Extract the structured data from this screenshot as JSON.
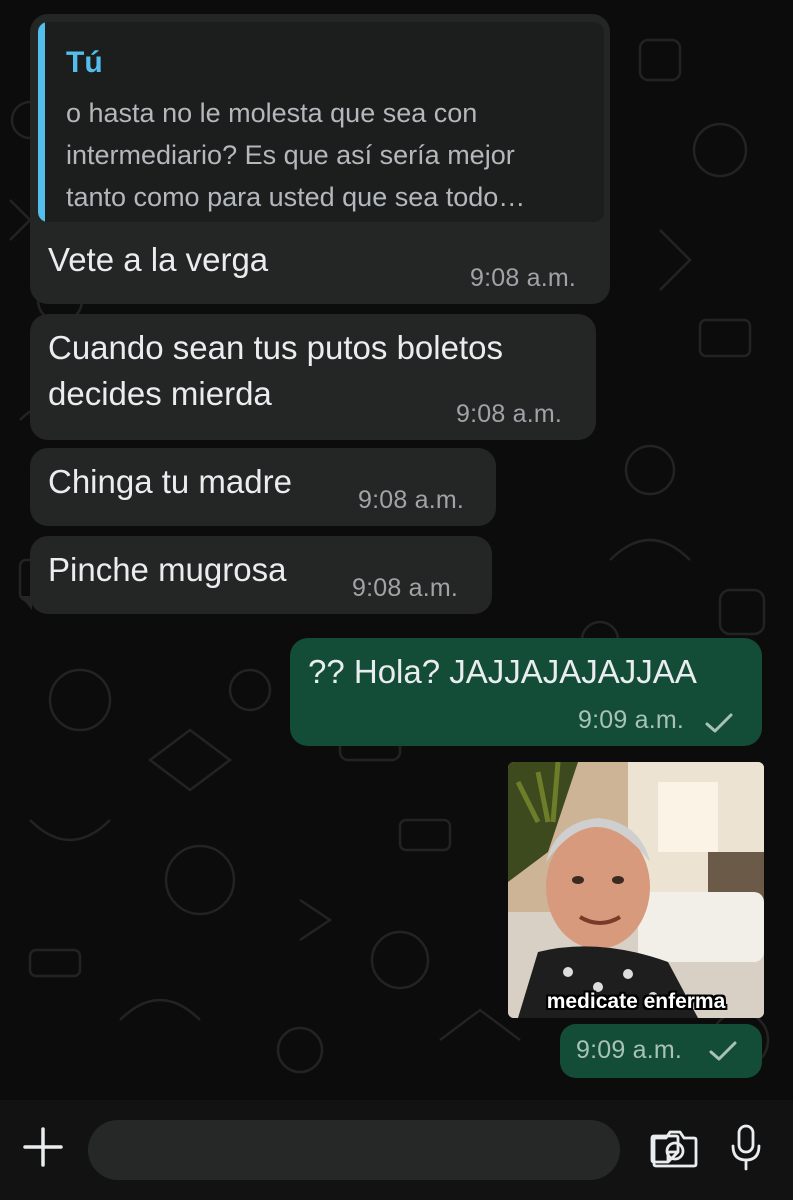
{
  "colors": {
    "incoming_bubble": "#242626",
    "outgoing_bubble": "#144d37",
    "quote_accent": "#53bdeb",
    "background": "#0b0b0b"
  },
  "messages": {
    "m1": {
      "quote": {
        "author": "Tú",
        "lines": [
          "o hasta no le molesta que sea con",
          "intermediario? Es que así sería mejor",
          "tanto como para usted que sea todo…"
        ]
      },
      "text": "Vete a la verga",
      "time": "9:08 a.m."
    },
    "m2": {
      "lines": [
        "Cuando sean tus putos boletos",
        "decides mierda"
      ],
      "time": "9:08 a.m."
    },
    "m3": {
      "text": "Chinga tu madre",
      "time": "9:08 a.m."
    },
    "m4": {
      "text": "Pinche mugrosa",
      "time": "9:08 a.m."
    },
    "m5": {
      "text": "?? Hola? JAJJAJAJAJJAA",
      "time": "9:09 a.m.",
      "status_icon": "check-icon"
    },
    "m6": {
      "image_caption": "medicate enferma",
      "time": "9:09 a.m.",
      "status_icon": "check-icon"
    }
  },
  "composer": {
    "icons": [
      "plus-icon",
      "sticker-icon",
      "camera-icon",
      "microphone-icon"
    ]
  }
}
